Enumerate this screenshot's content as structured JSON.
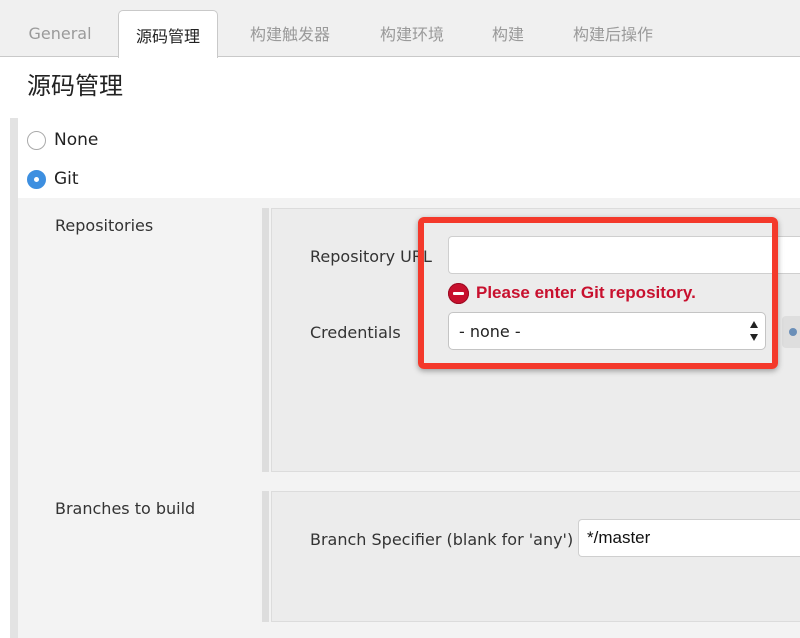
{
  "tabs": [
    {
      "label": "General",
      "active": false
    },
    {
      "label": "源码管理",
      "active": true
    },
    {
      "label": "构建触发器",
      "active": false
    },
    {
      "label": "构建环境",
      "active": false
    },
    {
      "label": "构建",
      "active": false
    },
    {
      "label": "构建后操作",
      "active": false
    }
  ],
  "section": {
    "title": "源码管理"
  },
  "scm_options": [
    {
      "label": "None",
      "checked": false
    },
    {
      "label": "Git",
      "checked": true
    }
  ],
  "repositories": {
    "label": "Repositories",
    "url_label": "Repository URL",
    "url_value": "",
    "error_message": "Please enter Git repository.",
    "credentials_label": "Credentials",
    "credentials_selected": "- none -"
  },
  "branches": {
    "label": "Branches to build",
    "specifier_label": "Branch Specifier (blank for 'any')",
    "specifier_value": "*/master"
  },
  "colors": {
    "accent": "#3d8fe0",
    "error": "#c8102e",
    "highlight": "#f4392b"
  }
}
